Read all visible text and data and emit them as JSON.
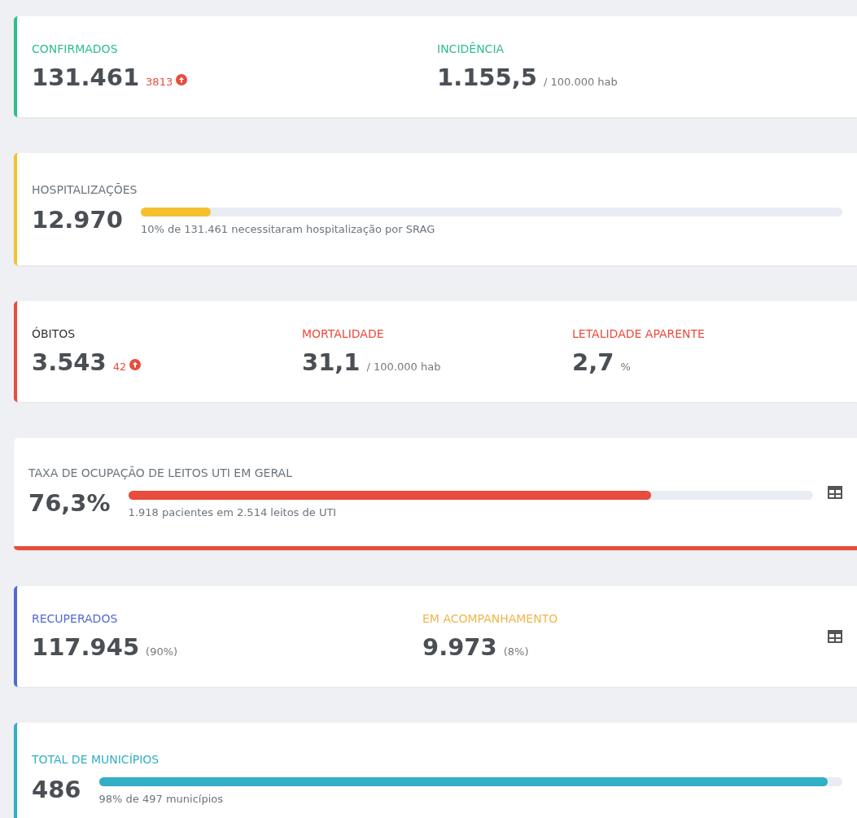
{
  "cards": [
    {
      "kind": "stats",
      "color": "#2ebf8a",
      "bottom_accent": false,
      "table_icon": false,
      "items": [
        {
          "label": "CONFIRMADOS",
          "color": "#2ebf8a",
          "value": "131.461",
          "delta": "3813"
        },
        {
          "label": "INCIDÊNCIA",
          "color": "#2ebf8a",
          "value": "1.155,5",
          "unit": "/ 100.000 hab"
        }
      ]
    },
    {
      "kind": "progress",
      "color": "#f5c02e",
      "bottom_accent": false,
      "table_icon": false,
      "title": {
        "text": "HOSPITALIZAÇÕES",
        "color": "#6c757d"
      },
      "value": "12.970",
      "level": 0.1,
      "caption": "10% de 131.461 necessitaram hospitalização por SRAG"
    },
    {
      "kind": "stats",
      "color": "#e74c3c",
      "bottom_accent": false,
      "table_icon": false,
      "items": [
        {
          "label": "ÓBITOS",
          "color": "#333333",
          "value": "3.543",
          "delta": "42"
        },
        {
          "label": "MORTALIDADE",
          "color": "#e74c3c",
          "value": "31,1",
          "unit": "/ 100.000 hab"
        },
        {
          "label": "LETALIDADE APARENTE",
          "color": "#e74c3c",
          "value": "2,7",
          "unit": "%"
        }
      ]
    },
    {
      "kind": "progress",
      "color": "#e74c3c",
      "bottom_accent": true,
      "table_icon": true,
      "title": {
        "text": "TAXA DE OCUPAÇÃO DE LEITOS UTI EM GERAL",
        "color": "#6c757d"
      },
      "value": "76,3%",
      "level": 0.763,
      "caption": "1.918 pacientes em 2.514 leitos de UTI"
    },
    {
      "kind": "stats",
      "color": "#5468d4",
      "bottom_accent": false,
      "table_icon": true,
      "items": [
        {
          "label": "RECUPERADOS",
          "color": "#5468d4",
          "value": "117.945",
          "unit": "(90%)"
        },
        {
          "label": "EM ACOMPANHAMENTO",
          "color": "#f1b44c",
          "value": "9.973",
          "unit": "(8%)"
        }
      ]
    },
    {
      "kind": "progress",
      "color": "#32aec6",
      "bottom_accent": false,
      "table_icon": false,
      "title": {
        "text": "TOTAL DE MUNICÍPIOS",
        "color": "#32aec6"
      },
      "value": "486",
      "level": 0.98,
      "caption": "98% de 497 municípios"
    }
  ]
}
